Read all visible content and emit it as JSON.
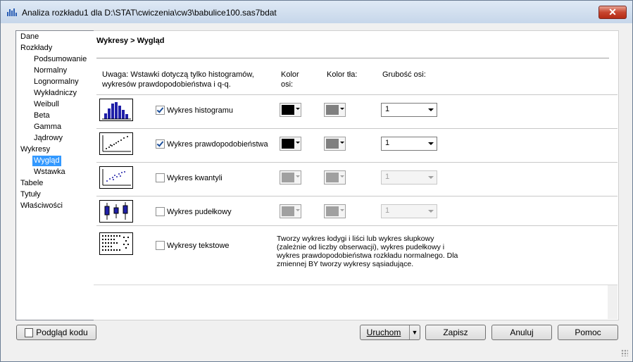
{
  "window": {
    "title": "Analiza rozkładu1 dla D:\\STAT\\cwiczenia\\cw3\\babulice100.sas7bdat",
    "close_symbol": "✕"
  },
  "nav": {
    "items": [
      {
        "label": "Dane",
        "level": 0
      },
      {
        "label": "Rozkłady",
        "level": 0
      },
      {
        "label": "Podsumowanie",
        "level": 1
      },
      {
        "label": "Normalny",
        "level": 1
      },
      {
        "label": "Lognormalny",
        "level": 1
      },
      {
        "label": "Wykładniczy",
        "level": 1
      },
      {
        "label": "Weibull",
        "level": 1
      },
      {
        "label": "Beta",
        "level": 1
      },
      {
        "label": "Gamma",
        "level": 1
      },
      {
        "label": "Jądrowy",
        "level": 1
      },
      {
        "label": "Wykresy",
        "level": 0
      },
      {
        "label": "Wygląd",
        "level": 1,
        "selected": true
      },
      {
        "label": "Wstawka",
        "level": 1
      },
      {
        "label": "Tabele",
        "level": 0
      },
      {
        "label": "Tytuły",
        "level": 0
      },
      {
        "label": "Właściwości",
        "level": 0
      }
    ]
  },
  "panel": {
    "heading": "Wykresy > Wygląd",
    "note": "Uwaga: Wstawki dotyczą tylko histogramów, wykresów prawdopodobieństwa i q-q.",
    "col_axis_color": "Kolor osi:",
    "col_bg_color": "Kolor tła:",
    "col_axis_width": "Grubość osi:",
    "rows": [
      {
        "label": "Wykres histogramu",
        "checked": true,
        "axis_color": "#000000",
        "bg_color": "#808080",
        "width": "1",
        "enabled": true
      },
      {
        "label": "Wykres prawdopodobieństwa",
        "checked": true,
        "axis_color": "#000000",
        "bg_color": "#808080",
        "width": "1",
        "enabled": true
      },
      {
        "label": "Wykres kwantyli",
        "checked": false,
        "axis_color": "#a0a0a0",
        "bg_color": "#a0a0a0",
        "width": "1",
        "enabled": false
      },
      {
        "label": "Wykres pudełkowy",
        "checked": false,
        "axis_color": "#a0a0a0",
        "bg_color": "#a0a0a0",
        "width": "1",
        "enabled": false
      },
      {
        "label": "Wykresy tekstowe",
        "checked": false
      }
    ],
    "text_desc": "Tworzy wykres łodygi i liści lub wykres słupkowy (zależnie od liczby obserwacji), wykres pudełkowy i wykres prawdopodobieństwa rozkładu normalnego. Dla zmiennej BY tworzy wykresy sąsiadujące."
  },
  "buttons": {
    "preview": "Podgląd kodu",
    "run": "Uruchom",
    "save": "Zapisz",
    "cancel": "Anuluj",
    "help": "Pomoc"
  },
  "colors": {
    "selection": "#3399ff",
    "chart_blue": "#1f1fa8"
  }
}
